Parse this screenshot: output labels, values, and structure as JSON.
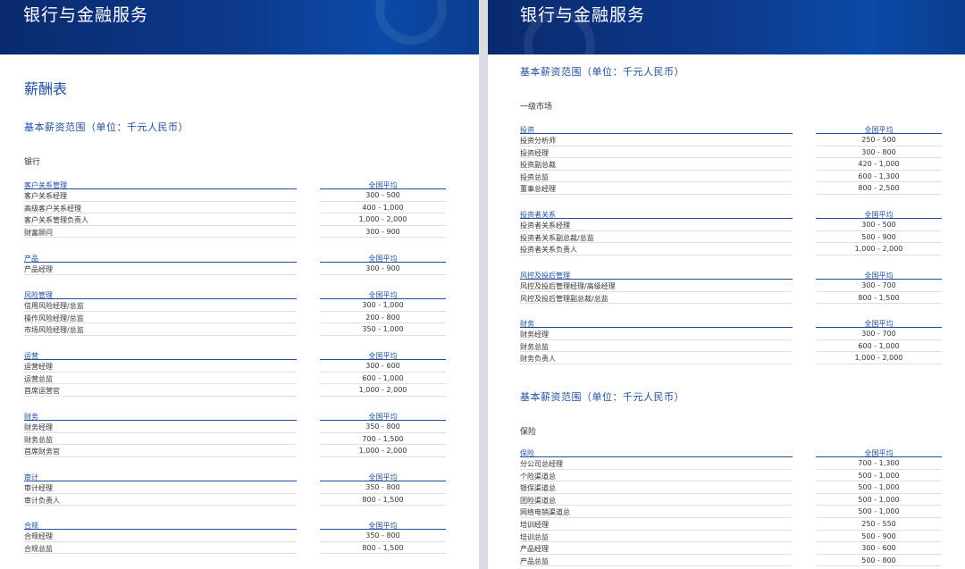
{
  "header": {
    "title": "银行与金融服务"
  },
  "left": {
    "page_title": "薪酬表",
    "section_title": "基本薪资范围（单位：千元人民币）",
    "subsection": "银行",
    "blocks": [
      {
        "category": "客户关系管理",
        "avg_label": "全国平均",
        "rows": [
          {
            "name": "客户关系经理",
            "value": "300 - 500"
          },
          {
            "name": "高级客户关系经理",
            "value": "400 - 1,000"
          },
          {
            "name": "客户关系管理负责人",
            "value": "1,000 - 2,000"
          },
          {
            "name": "财富顾问",
            "value": "300 - 900"
          }
        ]
      },
      {
        "category": "产品",
        "avg_label": "全国平均",
        "rows": [
          {
            "name": "产品经理",
            "value": "300 - 900"
          }
        ]
      },
      {
        "category": "风险管理",
        "avg_label": "全国平均",
        "rows": [
          {
            "name": "信用风险经理/总监",
            "value": "300 - 1,000"
          },
          {
            "name": "操作风险经理/总监",
            "value": "200 - 800"
          },
          {
            "name": "市场风险经理/总监",
            "value": "350 - 1,000"
          }
        ]
      },
      {
        "category": "运营",
        "avg_label": "全国平均",
        "rows": [
          {
            "name": "运营经理",
            "value": "300 - 600"
          },
          {
            "name": "运营总监",
            "value": "600 - 1,000"
          },
          {
            "name": "首席运营官",
            "value": "1,000 - 2,000"
          }
        ]
      },
      {
        "category": "财务",
        "avg_label": "全国平均",
        "rows": [
          {
            "name": "财务经理",
            "value": "350 - 800"
          },
          {
            "name": "财务总监",
            "value": "700 - 1,500"
          },
          {
            "name": "首席财务官",
            "value": "1,000 - 2,000"
          }
        ]
      },
      {
        "category": "审计",
        "avg_label": "全国平均",
        "rows": [
          {
            "name": "审计经理",
            "value": "350 - 800"
          },
          {
            "name": "审计负责人",
            "value": "800 - 1,500"
          }
        ]
      },
      {
        "category": "合规",
        "avg_label": "全国平均",
        "rows": [
          {
            "name": "合规经理",
            "value": "350 - 800"
          },
          {
            "name": "合规总监",
            "value": "800 - 1,500"
          }
        ]
      }
    ]
  },
  "right": {
    "section_title_1": "基本薪资范围（单位：千元人民币）",
    "subsection_1": "一级市场",
    "blocks_1": [
      {
        "category": "投资",
        "avg_label": "全国平均",
        "rows": [
          {
            "name": "投资分析师",
            "value": "250 - 500"
          },
          {
            "name": "投资经理",
            "value": "300 - 800"
          },
          {
            "name": "投资副总裁",
            "value": "420 - 1,000"
          },
          {
            "name": "投资总监",
            "value": "600 - 1,300"
          },
          {
            "name": "董事总经理",
            "value": "800 - 2,500"
          }
        ]
      },
      {
        "category": "投资者关系",
        "avg_label": "全国平均",
        "rows": [
          {
            "name": "投资者关系经理",
            "value": "300 - 500"
          },
          {
            "name": "投资者关系副总裁/总监",
            "value": "500 - 900"
          },
          {
            "name": "投资者关系负责人",
            "value": "1,000 - 2,000"
          }
        ]
      },
      {
        "category": "风控及投后管理",
        "avg_label": "全国平均",
        "rows": [
          {
            "name": "风控及投后管理经理/高级经理",
            "value": "300 - 700"
          },
          {
            "name": "风控及投后管理副总裁/总监",
            "value": "800 - 1,500"
          }
        ]
      },
      {
        "category": "财务",
        "avg_label": "全国平均",
        "rows": [
          {
            "name": "财务经理",
            "value": "300 - 700"
          },
          {
            "name": "财务总监",
            "value": "600 - 1,000"
          },
          {
            "name": "财务负责人",
            "value": "1,000 - 2,000"
          }
        ]
      }
    ],
    "section_title_2": "基本薪资范围（单位：千元人民币）",
    "subsection_2": "保险",
    "blocks_2": [
      {
        "category": "保险",
        "avg_label": "全国平均",
        "rows": [
          {
            "name": "分公司总经理",
            "value": "700 - 1,300"
          },
          {
            "name": "个险渠道总",
            "value": "500 - 1,000"
          },
          {
            "name": "银保渠道总",
            "value": "500 - 1,000"
          },
          {
            "name": "团险渠道总",
            "value": "500 - 1,000"
          },
          {
            "name": "网络电销渠道总",
            "value": "500 - 1,000"
          },
          {
            "name": "培训经理",
            "value": "250 - 550"
          },
          {
            "name": "培训总监",
            "value": "500 - 900"
          },
          {
            "name": "产品经理",
            "value": "300 - 600"
          },
          {
            "name": "产品总监",
            "value": "500 - 800"
          }
        ]
      }
    ]
  }
}
